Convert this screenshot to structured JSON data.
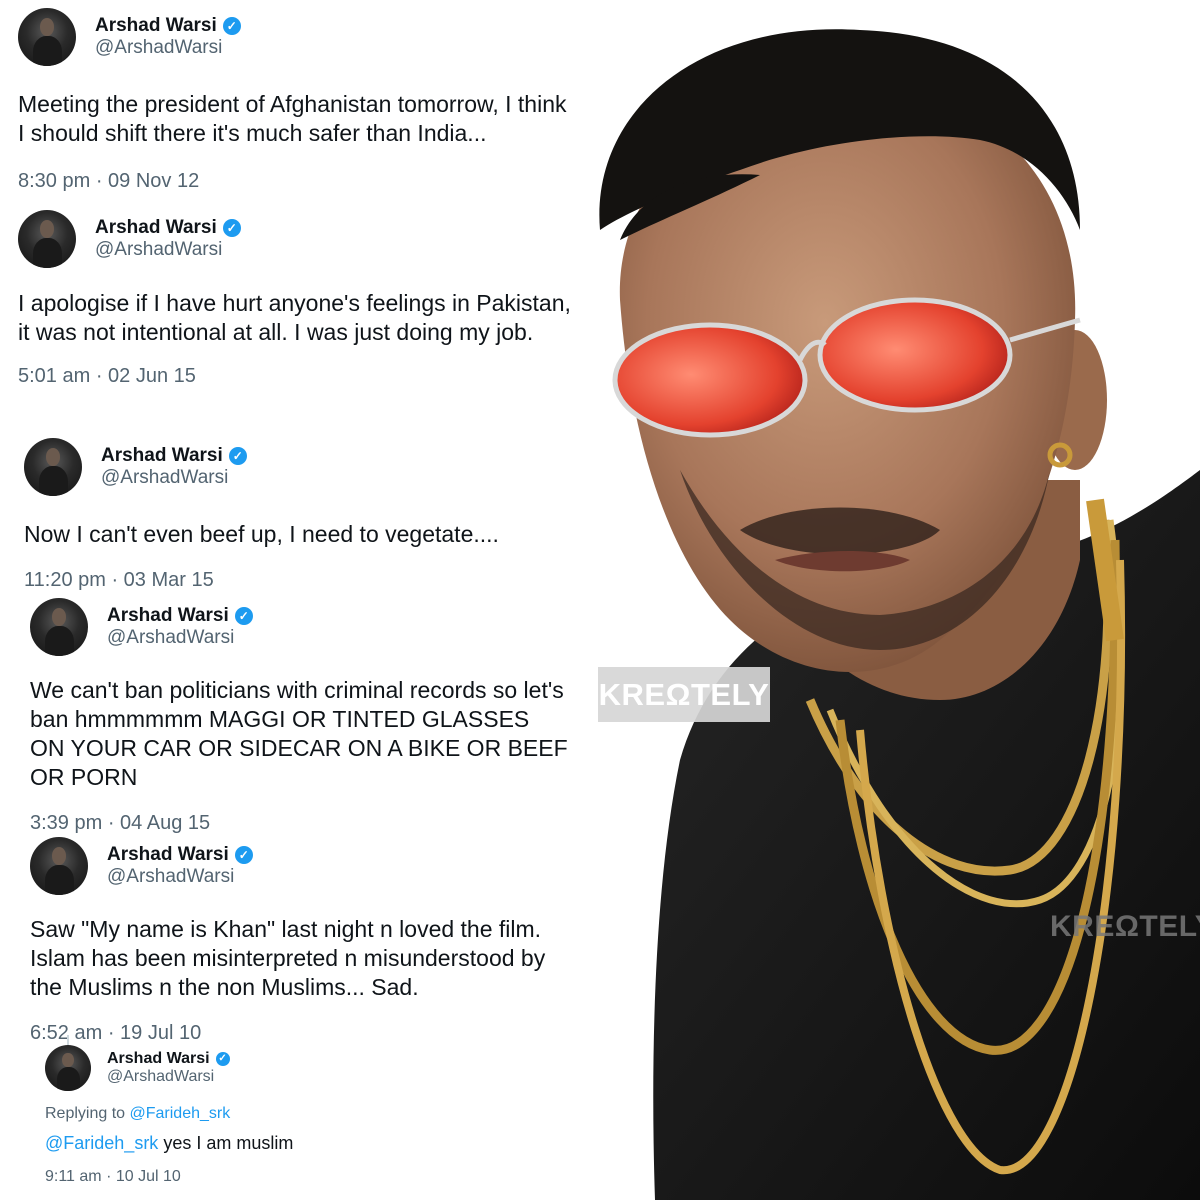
{
  "tweets": [
    {
      "name": "Arshad Warsi",
      "handle": "@ArshadWarsi",
      "text": "Meeting the president of Afghanistan tomorrow, I think I should shift there it's much safer than India...",
      "time": "8:30 pm · 09 Nov 12"
    },
    {
      "name": "Arshad Warsi",
      "handle": "@ArshadWarsi",
      "text": "I apologise if I have hurt anyone's feelings in Pakistan, it was not intentional at all. I was just doing my job.",
      "time": "5:01 am · 02 Jun 15"
    },
    {
      "name": "Arshad Warsi",
      "handle": "@ArshadWarsi",
      "text": "Now I can't even beef up, I need to vegetate....",
      "time": "11:20 pm · 03 Mar 15"
    },
    {
      "name": "Arshad Warsi",
      "handle": "@ArshadWarsi",
      "text": "We can't ban politicians with criminal records so let's ban hmmmmmm MAGGI OR TINTED GLASSES ON YOUR CAR OR SIDECAR ON A BIKE OR BEEF OR PORN",
      "time": "3:39 pm · 04 Aug 15"
    },
    {
      "name": "Arshad Warsi",
      "handle": "@ArshadWarsi",
      "text": "Saw \"My name is Khan\" last night n loved the film. Islam has been misinterpreted n misunderstood by the Muslims n the non Muslims... Sad.",
      "time": "6:52 am · 19 Jul 10"
    },
    {
      "name": "Arshad Warsi",
      "handle": "@ArshadWarsi",
      "replying_prefix": "Replying to ",
      "replying_to": "@Farideh_srk",
      "mention": "@Farideh_srk",
      "text": " yes I am muslim",
      "time": "9:11 am · 10 Jul 10"
    }
  ],
  "watermark": "KREΩTELY",
  "colors": {
    "text": "#0f1419",
    "secondary": "#536471",
    "verified": "#1d9bf0",
    "link": "#1d9bf0"
  },
  "icons": {
    "verified": "verified-badge-icon",
    "avatar": "profile-avatar"
  }
}
